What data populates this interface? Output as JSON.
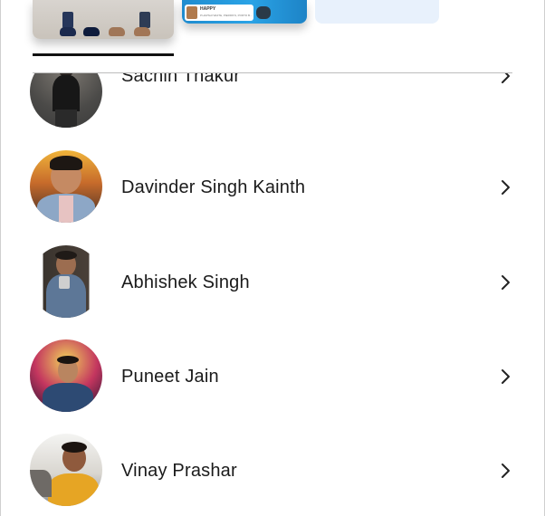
{
  "carousel": {
    "cards": [
      {
        "id": "photo-card-1"
      },
      {
        "id": "photo-card-2",
        "badge_title": "HAPPY",
        "badge_sub": "P.HAPSHI WHITE, PIERIPA'S, PORTO B..."
      },
      {
        "id": "photo-card-3"
      }
    ]
  },
  "people": [
    {
      "name": "Sachin Thakur"
    },
    {
      "name": "Davinder Singh Kainth"
    },
    {
      "name": "Abhishek Singh"
    },
    {
      "name": "Puneet Jain"
    },
    {
      "name": "Vinay Prashar"
    }
  ],
  "icons": {
    "row_action": "chevron-right-icon"
  },
  "colors": {
    "text": "#1a1a1a",
    "indicator": "#111111",
    "divider": "#bdbdbd",
    "card_light": "#e8f1fc"
  }
}
